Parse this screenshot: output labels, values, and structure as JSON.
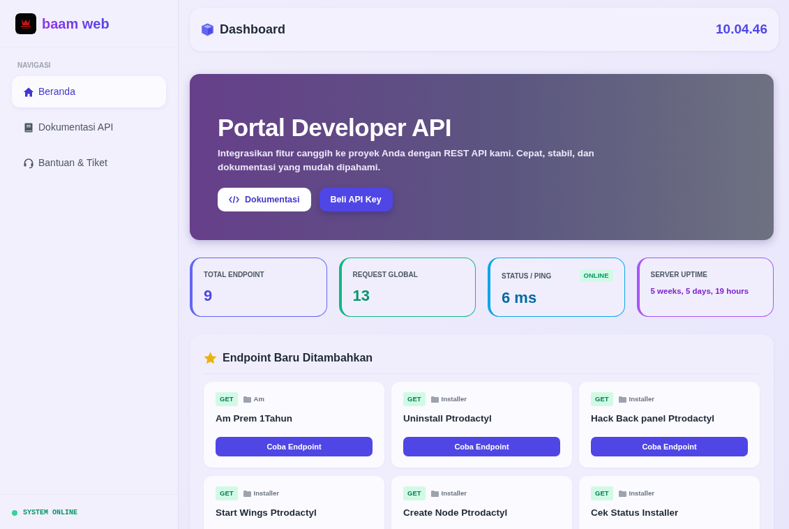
{
  "brand": {
    "name": "baam web"
  },
  "sidebar": {
    "section_label": "NAVIGASI",
    "items": [
      {
        "label": "Beranda",
        "kind": "home",
        "selected": true
      },
      {
        "label": "Dokumentasi API",
        "kind": "book",
        "selected": false
      },
      {
        "label": "Bantuan & Tiket",
        "kind": "headset",
        "selected": false
      }
    ],
    "status": {
      "text": "SYSTEM ONLINE",
      "color": "#34d399"
    }
  },
  "header": {
    "title": "Dashboard",
    "time": "10.04.46"
  },
  "hero": {
    "title": "Portal Developer API",
    "text": "Integrasikan fitur canggih ke proyek Anda dengan REST API kami. Cepat, stabil, dan dokumentasi yang mudah dipahami.",
    "buttons": [
      {
        "label": "Dokumentasi",
        "kind": "light"
      },
      {
        "label": "Beli API Key",
        "kind": "primary"
      }
    ]
  },
  "stats": [
    {
      "label": "TOTAL ENDPOINT",
      "value": "9",
      "kind": "number",
      "color": "#6366f1"
    },
    {
      "label": "REQUEST GLOBAL",
      "value": "13",
      "kind": "number",
      "color": "#10b981"
    },
    {
      "label": "STATUS / PING",
      "value": "6 ms",
      "kind": "number",
      "color": "#0ea5e9",
      "badge": "ONLINE"
    },
    {
      "label": "SERVER UPTIME",
      "value": "5 weeks, 5 days, 19 hours",
      "kind": "text",
      "color": "#a855f7"
    }
  ],
  "endpoints": {
    "title": "Endpoint Baru Ditambahkan",
    "items": [
      {
        "method": "GET",
        "category": "Am",
        "name": "Am Prem 1Tahun",
        "button": "Coba Endpoint"
      },
      {
        "method": "GET",
        "category": "Installer",
        "name": "Uninstall Ptrodactyl",
        "button": "Coba Endpoint"
      },
      {
        "method": "GET",
        "category": "Installer",
        "name": "Hack Back panel Ptrodactyl",
        "button": "Coba Endpoint"
      },
      {
        "method": "GET",
        "category": "Installer",
        "name": "Start Wings Ptrodactyl"
      },
      {
        "method": "GET",
        "category": "Installer",
        "name": "Create Node Ptrodactyl"
      },
      {
        "method": "GET",
        "category": "Installer",
        "name": "Cek Status Installer"
      }
    ]
  }
}
